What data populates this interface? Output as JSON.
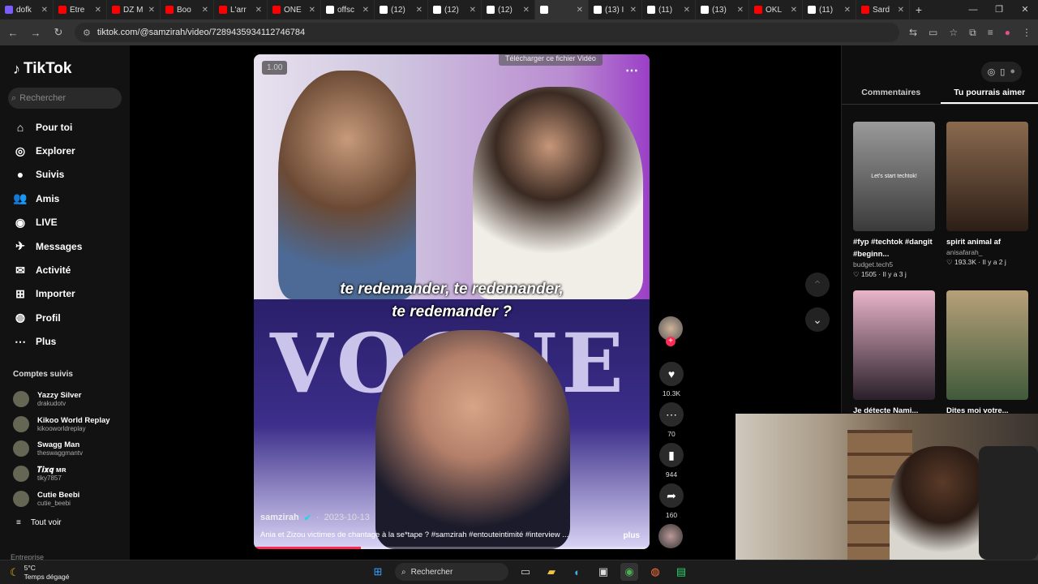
{
  "browser": {
    "tabs": [
      {
        "label": "dofk",
        "color": "#7b5cff"
      },
      {
        "label": "Être",
        "color": "#ff0000"
      },
      {
        "label": "DZ M",
        "color": "#ff0000"
      },
      {
        "label": "Boo",
        "color": "#ff0000"
      },
      {
        "label": "L'arr",
        "color": "#ff0000"
      },
      {
        "label": "ONE",
        "color": "#ff0000"
      },
      {
        "label": "offsc",
        "color": "#ffffff"
      },
      {
        "label": "(12)",
        "color": "#ffffff"
      },
      {
        "label": "(12)",
        "color": "#ffffff"
      },
      {
        "label": "(12)",
        "color": "#ffffff"
      },
      {
        "label": "",
        "color": "#ffffff",
        "active": true
      },
      {
        "label": "(13) I",
        "color": "#ffffff"
      },
      {
        "label": "(11)",
        "color": "#ffffff"
      },
      {
        "label": "(13)",
        "color": "#ffffff"
      },
      {
        "label": "OKL",
        "color": "#ff0000"
      },
      {
        "label": "(11)",
        "color": "#ffffff"
      },
      {
        "label": "Sard",
        "color": "#ff0000"
      }
    ],
    "url": "tiktok.com/@samzirah/video/7289435934112746784"
  },
  "sidebar": {
    "logo": "TikTok",
    "search_placeholder": "Rechercher",
    "nav": [
      {
        "icon": "home-icon",
        "label": "Pour toi"
      },
      {
        "icon": "compass-icon",
        "label": "Explorer"
      },
      {
        "icon": "following-icon",
        "label": "Suivis"
      },
      {
        "icon": "friends-icon",
        "label": "Amis"
      },
      {
        "icon": "live-icon",
        "label": "LIVE"
      },
      {
        "icon": "messages-icon",
        "label": "Messages"
      },
      {
        "icon": "activity-icon",
        "label": "Activité"
      },
      {
        "icon": "upload-icon",
        "label": "Importer"
      },
      {
        "icon": "profile-icon",
        "label": "Profil"
      },
      {
        "icon": "more-icon",
        "label": "Plus"
      }
    ],
    "followed_title": "Comptes suivis",
    "followed": [
      {
        "name": "Yazzy Silver",
        "handle": "drakudotv"
      },
      {
        "name": "Kikoo World Replay",
        "handle": "kikooworldreplay"
      },
      {
        "name": "Swagg Man",
        "handle": "theswaggmantv"
      },
      {
        "name": "𝑻𝒊𝒙𝒒 ᴍʀ",
        "handle": "tiky7857"
      },
      {
        "name": "Cutie Beebi",
        "handle": "cutie_beebi"
      }
    ],
    "see_all": "Tout voir",
    "footer": "Entreprise"
  },
  "video": {
    "speed": "1.00",
    "download_banner": "Télécharger ce fichier Vidéo",
    "subtitle_line1": "te redemander, te redemander,",
    "subtitle_line2": "te redemander ?",
    "vogue": "VOGUE",
    "author": "samzirah",
    "date": "2023-10-13",
    "caption": "Ania et Zizou victimes de chantage à la se*tape ? #samzirah #entouteintimité #interview ...",
    "more": "plus",
    "progress": 0.27
  },
  "actions": {
    "likes": "10.3K",
    "comments": "70",
    "saves": "944",
    "shares": "160"
  },
  "right_panel": {
    "tabs": [
      "Commentaires",
      "Tu pourrais aimer"
    ],
    "cards": [
      {
        "title": "#fyp #techtok #dangit #beginn...",
        "user": "budget.tech5",
        "likes": "1505",
        "age": "Il y a 3 j",
        "thumb_text": "Let's start techtok!",
        "color_a": "#9a9a9a",
        "color_b": "#3a3a3a"
      },
      {
        "title": "spirit animal af",
        "user": "anisafarah_",
        "likes": "193.3K",
        "age": "Il y a 2 j",
        "thumb_text": "",
        "color_a": "#8a6a4e",
        "color_b": "#2c1e16"
      },
      {
        "title": "Je détecte Nami...",
        "user": "",
        "likes": "",
        "age": "",
        "thumb_text": "",
        "color_a": "#e8b4c8",
        "color_b": "#2a1f2a"
      },
      {
        "title": "Dites moi votre...",
        "user": "",
        "likes": "",
        "age": "",
        "thumb_text": "",
        "color_a": "#b7a07a",
        "color_b": "#3f5a3a"
      }
    ]
  },
  "taskbar": {
    "temp": "5°C",
    "weather": "Temps dégagé",
    "search": "Rechercher"
  },
  "colors": {
    "accent": "#fe2c55",
    "bg": "#000000"
  }
}
